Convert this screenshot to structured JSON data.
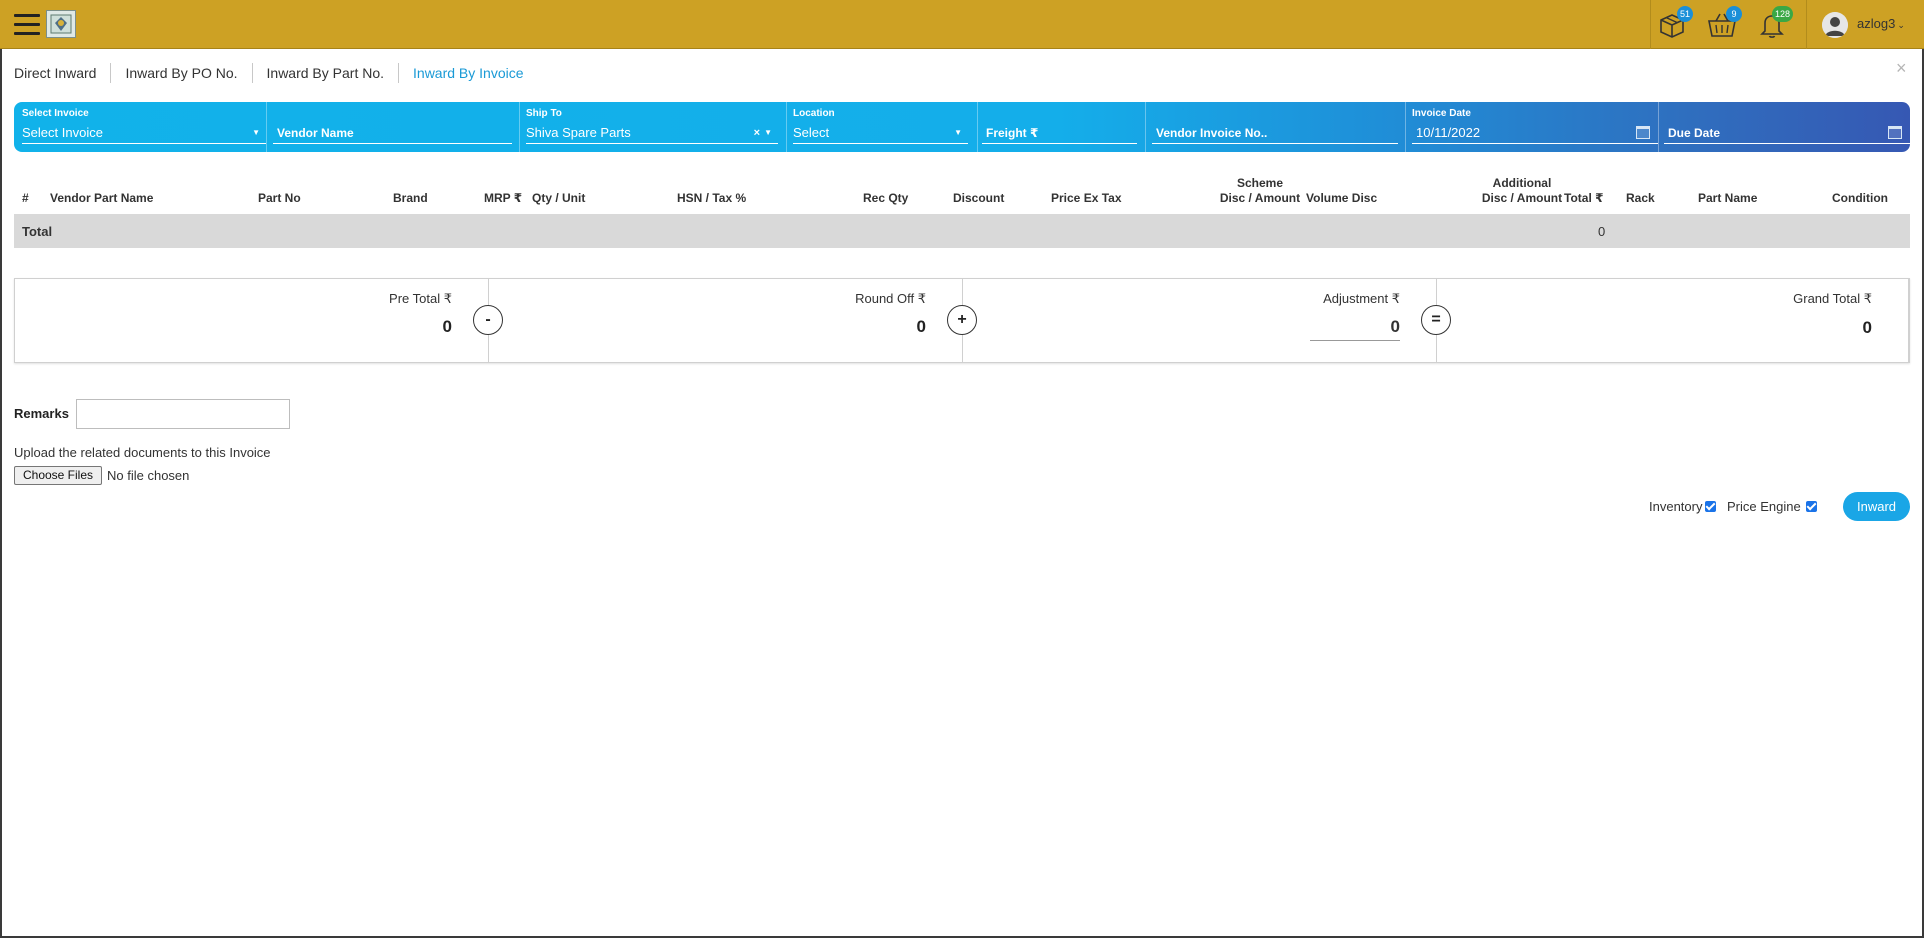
{
  "colors": {
    "topbar": "#cda124",
    "accent": "#1a9ad6",
    "filterbar_start": "#11b2ea",
    "filterbar_end": "#3658b3",
    "total_row": "#d9d9d9",
    "button": "#1aa6e6"
  },
  "topbar": {
    "menu_icon": "hamburger-icon",
    "logo_icon": "company-logo",
    "badges": {
      "parcel": "51",
      "basket": "9",
      "notifications": "128"
    },
    "user": "azlog3"
  },
  "tabs": [
    {
      "label": "Direct Inward"
    },
    {
      "label": "Inward By PO No."
    },
    {
      "label": "Inward By Part No."
    },
    {
      "label": "Inward By Invoice",
      "active": true
    }
  ],
  "filters": {
    "select_invoice": {
      "label": "Select Invoice",
      "value": "Select Invoice"
    },
    "vendor_name": {
      "placeholder": "Vendor Name"
    },
    "ship_to": {
      "label": "Ship To",
      "value": "Shiva Spare Parts"
    },
    "location": {
      "label": "Location",
      "value": "Select"
    },
    "freight": {
      "placeholder": "Freight ₹"
    },
    "vendor_invoice_no": {
      "placeholder": "Vendor Invoice No.."
    },
    "invoice_date": {
      "label": "Invoice Date",
      "value": "10/11/2022"
    },
    "due_date": {
      "placeholder": "Due Date"
    }
  },
  "table": {
    "headers": {
      "index": "#",
      "vendor_part_name": "Vendor Part Name",
      "part_no": "Part No",
      "brand": "Brand",
      "mrp": "MRP ₹",
      "qty_unit": "Qty / Unit",
      "hsn_tax": "HSN / Tax %",
      "rec_qty": "Rec Qty",
      "discount": "Discount",
      "price_ex_tax": "Price Ex Tax",
      "scheme_1": "Scheme",
      "scheme_2": "Disc / Amount",
      "volume_disc": "Volume Disc",
      "additional_1": "Additional",
      "additional_2": "Disc / Amount",
      "total": "Total ₹",
      "rack": "Rack",
      "part_name": "Part Name",
      "condition": "Condition"
    },
    "total_label": "Total",
    "total_value": "0"
  },
  "summary": {
    "pre_total": {
      "label": "Pre Total ₹",
      "value": "0"
    },
    "round_off": {
      "label": "Round Off ₹",
      "value": "0"
    },
    "adjustment": {
      "label": "Adjustment ₹",
      "value": "0"
    },
    "grand_total": {
      "label": "Grand Total ₹",
      "value": "0"
    },
    "ops": {
      "minus": "-",
      "plus": "+",
      "equals": "="
    }
  },
  "remarks": {
    "label": "Remarks",
    "value": ""
  },
  "upload": {
    "label": "Upload the related documents to this Invoice",
    "button": "Choose Files",
    "status": "No file chosen"
  },
  "options": {
    "inventory": {
      "label": "Inventory",
      "checked": true
    },
    "price_engine": {
      "label": "Price Engine",
      "checked": true
    }
  },
  "actions": {
    "inward": "Inward"
  },
  "close_symbol": "×"
}
